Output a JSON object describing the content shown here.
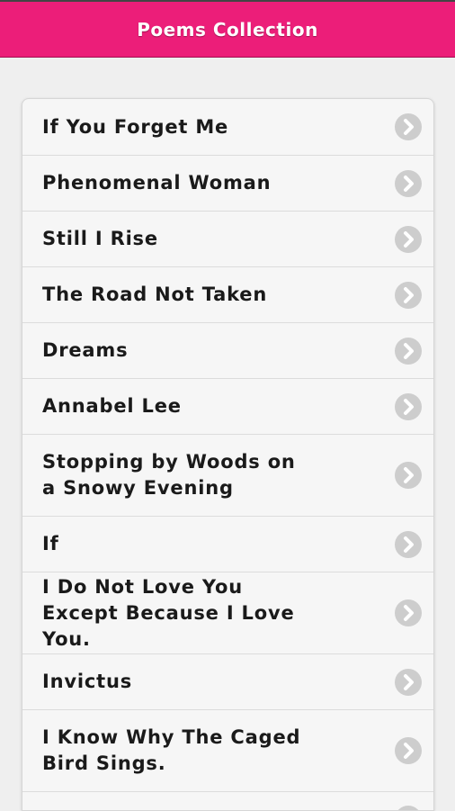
{
  "header": {
    "title": "Poems Collection"
  },
  "colors": {
    "accent": "#ec1e79"
  },
  "poems": [
    "If You Forget Me",
    "Phenomenal Woman",
    "Still I Rise",
    "The Road Not Taken",
    "Dreams",
    "Annabel Lee",
    "Stopping by Woods on a Snowy Evening",
    "If",
    "I Do Not Love You Except Because I Love You.",
    "Invictus",
    "I Know Why The Caged Bird Sings."
  ],
  "icons": {
    "row_action": "chevron-right-icon"
  }
}
